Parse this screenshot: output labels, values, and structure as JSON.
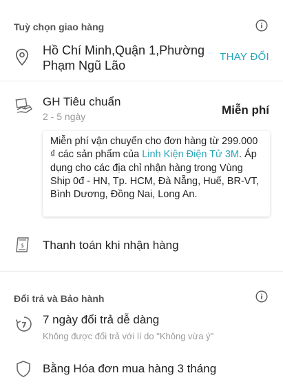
{
  "delivery": {
    "header": "Tuỳ chọn giao hàng",
    "address": "Hồ Chí Minh,Quận 1,Phường Phạm Ngũ Lão",
    "change_label": "THAY ĐỔI",
    "shipping_name": "GH Tiêu chuẩn",
    "shipping_days": "2 - 5 ngày",
    "shipping_fee": "Miễn phí",
    "promo_part1": "Miễn phí vận chuyển cho đơn hàng từ 299.000 ₫ các sản phẩm của ",
    "promo_link": "Linh Kiện Điện Tử 3M",
    "promo_part2": ". Áp dụng cho các địa chỉ nhận hàng trong Vùng Ship 0đ - HN, Tp. HCM, Đà Nẵng, Huế, BR-VT, Bình Dương, Đồng Nai, Long An.",
    "payment_label": "Thanh toán khi nhận hàng"
  },
  "returns": {
    "header": "Đổi trả và Bảo hành",
    "return_title": "7 ngày đổi trả dễ dàng",
    "return_sub": "Không được đổi trả với lí do \"Không vừa ý\"",
    "warranty_label": "Bằng Hóa đơn mua hàng 3 tháng"
  },
  "colors": {
    "accent": "#26a5b8",
    "muted": "#9a9a9a",
    "icon": "#555555"
  },
  "icons": [
    "info-icon",
    "location-pin-icon",
    "delivery-handover-icon",
    "cash-icon",
    "return-7-icon",
    "shield-icon"
  ]
}
